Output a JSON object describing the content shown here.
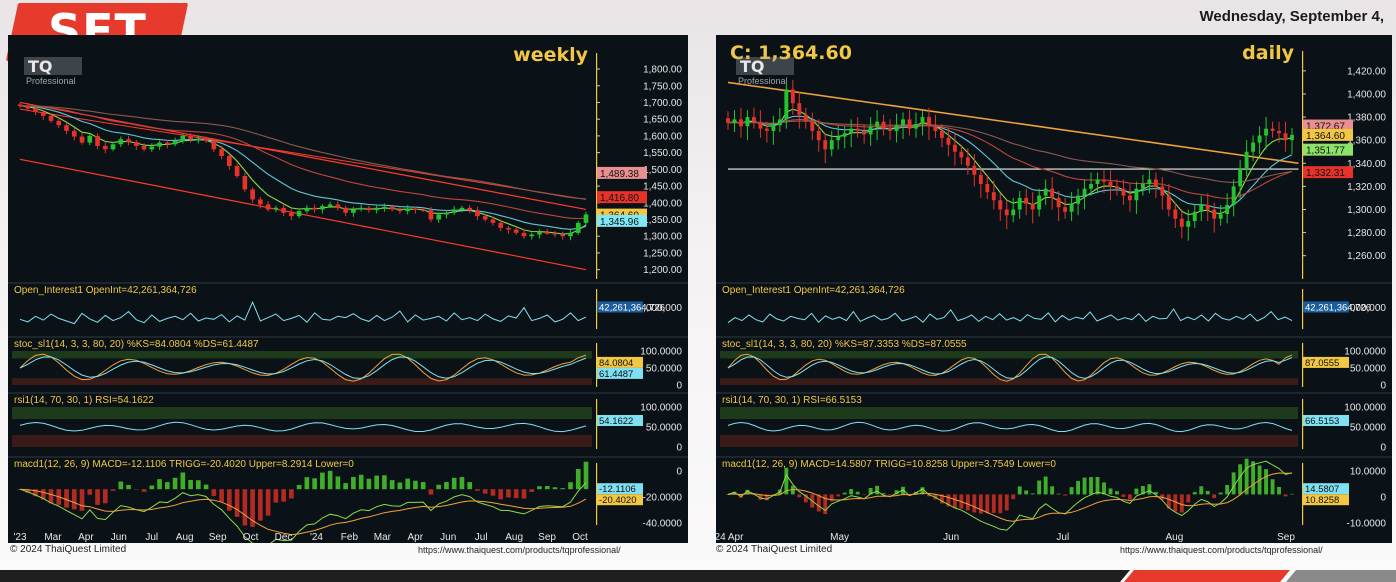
{
  "header": {
    "badge": "SET",
    "date": "Wednesday, September 4,"
  },
  "footer": {
    "copyright": "© 2024 ThaiQuest Limited",
    "url": "https://www.thaiquest.com/products/tqprofessional/"
  },
  "colors": {
    "background": "#0b1217",
    "up_candle": "#25c32e",
    "down_candle": "#e5322a",
    "channel": "#ff3b2b",
    "ema_slow": "#b44a48",
    "label_orange": "#f2c744",
    "badge_red": "#e63a2c"
  },
  "chart_data": [
    {
      "type": "line",
      "id": "weekly",
      "title": "weekly",
      "logo_text": "TQ",
      "logo_sub": "Professional",
      "y_ticks": [
        "1,800.00",
        "1,750.00",
        "1,700.00",
        "1,650.00",
        "1,600.00",
        "1,550.00",
        "1,500.00",
        "1,450.00",
        "1,400.00",
        "1,350.00",
        "1,300.00",
        "1,250.00",
        "1,200.00"
      ],
      "ylim": [
        1190,
        1830
      ],
      "x_tick_labels": [
        "'23",
        "Mar",
        "Apr",
        "Jun",
        "Jul",
        "Aug",
        "Sep",
        "Oct",
        "Dec",
        "'24",
        "Feb",
        "Mar",
        "Apr",
        "Jun",
        "Jul",
        "Aug",
        "Sep",
        "Oct"
      ],
      "close": [
        1690,
        1682,
        1672,
        1660,
        1645,
        1632,
        1615,
        1598,
        1580,
        1600,
        1570,
        1560,
        1575,
        1590,
        1582,
        1570,
        1560,
        1568,
        1580,
        1575,
        1585,
        1600,
        1590,
        1592,
        1585,
        1560,
        1540,
        1510,
        1480,
        1440,
        1410,
        1395,
        1380,
        1385,
        1370,
        1360,
        1375,
        1385,
        1380,
        1390,
        1395,
        1385,
        1370,
        1380,
        1385,
        1378,
        1385,
        1388,
        1380,
        1375,
        1383,
        1380,
        1378,
        1350,
        1365,
        1370,
        1380,
        1385,
        1378,
        1360,
        1350,
        1340,
        1325,
        1320,
        1310,
        1300,
        1305,
        1312,
        1310,
        1305,
        1300,
        1310,
        1340,
        1365
      ],
      "value_labels": [
        {
          "text": "1,489.38",
          "value": 1489.38,
          "bg": "#e98f92"
        },
        {
          "text": "1,416.80",
          "value": 1416.8,
          "bg": "#e5322a"
        },
        {
          "text": "1,364.60",
          "value": 1364.6,
          "bg": "#f2c744"
        },
        {
          "text": "1,345.96",
          "value": 1345.96,
          "bg": "#7fe8f5"
        }
      ],
      "indicators": [
        {
          "label": "Open_Interest1 OpenInt=42,261,364,726",
          "ticks": [
            "60,000,000,000"
          ],
          "value_label": "42,261,364,726",
          "values": [
            48,
            42,
            55,
            46,
            60,
            50,
            44,
            38,
            62,
            49,
            41,
            57,
            45,
            52,
            66,
            47,
            40,
            58,
            43,
            50,
            55,
            47,
            62,
            44,
            51,
            48,
            59,
            42,
            56,
            46,
            88,
            44,
            52,
            60,
            45,
            50,
            57,
            41,
            63,
            48,
            46,
            55,
            52,
            61,
            49,
            43,
            57,
            45,
            53,
            67,
            42,
            58,
            46,
            50,
            55,
            44,
            63,
            47,
            52,
            45,
            60,
            49,
            43,
            56,
            51,
            75,
            45,
            50,
            58,
            42,
            48,
            63,
            45,
            53
          ]
        },
        {
          "label": "stoc_sl1(14, 3, 3, 80, 20) %KS=84.0804 %DS=61.4487",
          "ticks": [
            "100.0000",
            "50.0000",
            "0"
          ],
          "value_labels": [
            "84.0804",
            "61.4487"
          ]
        },
        {
          "label": "rsi1(14, 70, 30, 1) RSI=54.1622",
          "ticks": [
            "100.0000",
            "50.0000",
            "0"
          ],
          "value_label": "54.1622"
        },
        {
          "label": "macd1(12, 26, 9) MACD=-12.1106 TRIGG=-20.4020 Upper=8.2914 Lower=0",
          "ticks": [
            "0",
            "-20.0000",
            "-40.0000"
          ],
          "value_labels": [
            "-12.1106",
            "-20.4020"
          ]
        }
      ]
    },
    {
      "type": "line",
      "id": "daily",
      "title": "daily",
      "last_close_label": "C: 1,364.60",
      "logo_text": "TQ",
      "logo_sub": "Professional",
      "y_ticks": [
        "1,420.00",
        "1,400.00",
        "1,380.00",
        "1,360.00",
        "1,340.00",
        "1,320.00",
        "1,300.00",
        "1,280.00",
        "1,260.00"
      ],
      "ylim": [
        1245,
        1432
      ],
      "x_tick_labels": [
        "'24 Apr",
        "May",
        "Jun",
        "Jul",
        "Aug",
        "Sep"
      ],
      "close": [
        1375,
        1378,
        1372,
        1380,
        1376,
        1370,
        1368,
        1373,
        1378,
        1404,
        1392,
        1382,
        1376,
        1368,
        1360,
        1352,
        1360,
        1363,
        1366,
        1370,
        1368,
        1365,
        1372,
        1376,
        1370,
        1368,
        1373,
        1378,
        1370,
        1374,
        1380,
        1372,
        1368,
        1362,
        1356,
        1350,
        1345,
        1338,
        1330,
        1322,
        1315,
        1308,
        1300,
        1295,
        1300,
        1310,
        1305,
        1300,
        1312,
        1318,
        1310,
        1302,
        1298,
        1305,
        1312,
        1318,
        1322,
        1326,
        1324,
        1320,
        1318,
        1312,
        1308,
        1318,
        1322,
        1326,
        1320,
        1312,
        1300,
        1292,
        1285,
        1290,
        1298,
        1304,
        1300,
        1292,
        1296,
        1304,
        1320,
        1335,
        1350,
        1358,
        1364,
        1370,
        1368,
        1366,
        1360,
        1364.6
      ],
      "value_labels": [
        {
          "text": "1,372.67",
          "value": 1372.67,
          "bg": "#e98f92"
        },
        {
          "text": "1,364.60",
          "value": 1364.6,
          "bg": "#f2c744"
        },
        {
          "text": "1,351.77",
          "value": 1351.77,
          "bg": "#8de36a"
        },
        {
          "text": "1,332.31",
          "value": 1332.31,
          "bg": "#e5322a"
        }
      ],
      "indicators": [
        {
          "label": "Open_Interest1 OpenInt=42,261,364,726",
          "ticks": [
            "60,000,000,000"
          ],
          "value_label": "42,261,364,726",
          "values": [
            40,
            52,
            45,
            58,
            47,
            42,
            60,
            49,
            44,
            55,
            50,
            47,
            62,
            41,
            56,
            48,
            53,
            45,
            66,
            43,
            51,
            57,
            46,
            50,
            62,
            44,
            49,
            55,
            41,
            60,
            48,
            52,
            70,
            45,
            50,
            58,
            43,
            55,
            47,
            61,
            46,
            52,
            44,
            59,
            50,
            48,
            63,
            42,
            57,
            46,
            53,
            49,
            65,
            44,
            51,
            58,
            46,
            52,
            47,
            61,
            43,
            55,
            49,
            50,
            72,
            45,
            53,
            47,
            58,
            44,
            62,
            50,
            46,
            55,
            48,
            60,
            44,
            52,
            66,
            47,
            53,
            45
          ]
        },
        {
          "label": "stoc_sl1(14, 3, 3, 80, 20) %KS=87.3353 %DS=87.0555",
          "ticks": [
            "100.0000",
            "50.0000",
            "0"
          ],
          "value_labels": [
            "87.0555"
          ]
        },
        {
          "label": "rsi1(14, 70, 30, 1) RSI=66.5153",
          "ticks": [
            "100.0000",
            "50.0000",
            "0"
          ],
          "value_label": "66.5153"
        },
        {
          "label": "macd1(12, 26, 9) MACD=14.5807 TRIGG=10.8258 Upper=3.7549 Lower=0",
          "ticks": [
            "10.0000",
            "0",
            "-10.0000"
          ],
          "value_labels": [
            "14.5807",
            "10.8258"
          ]
        }
      ]
    }
  ]
}
